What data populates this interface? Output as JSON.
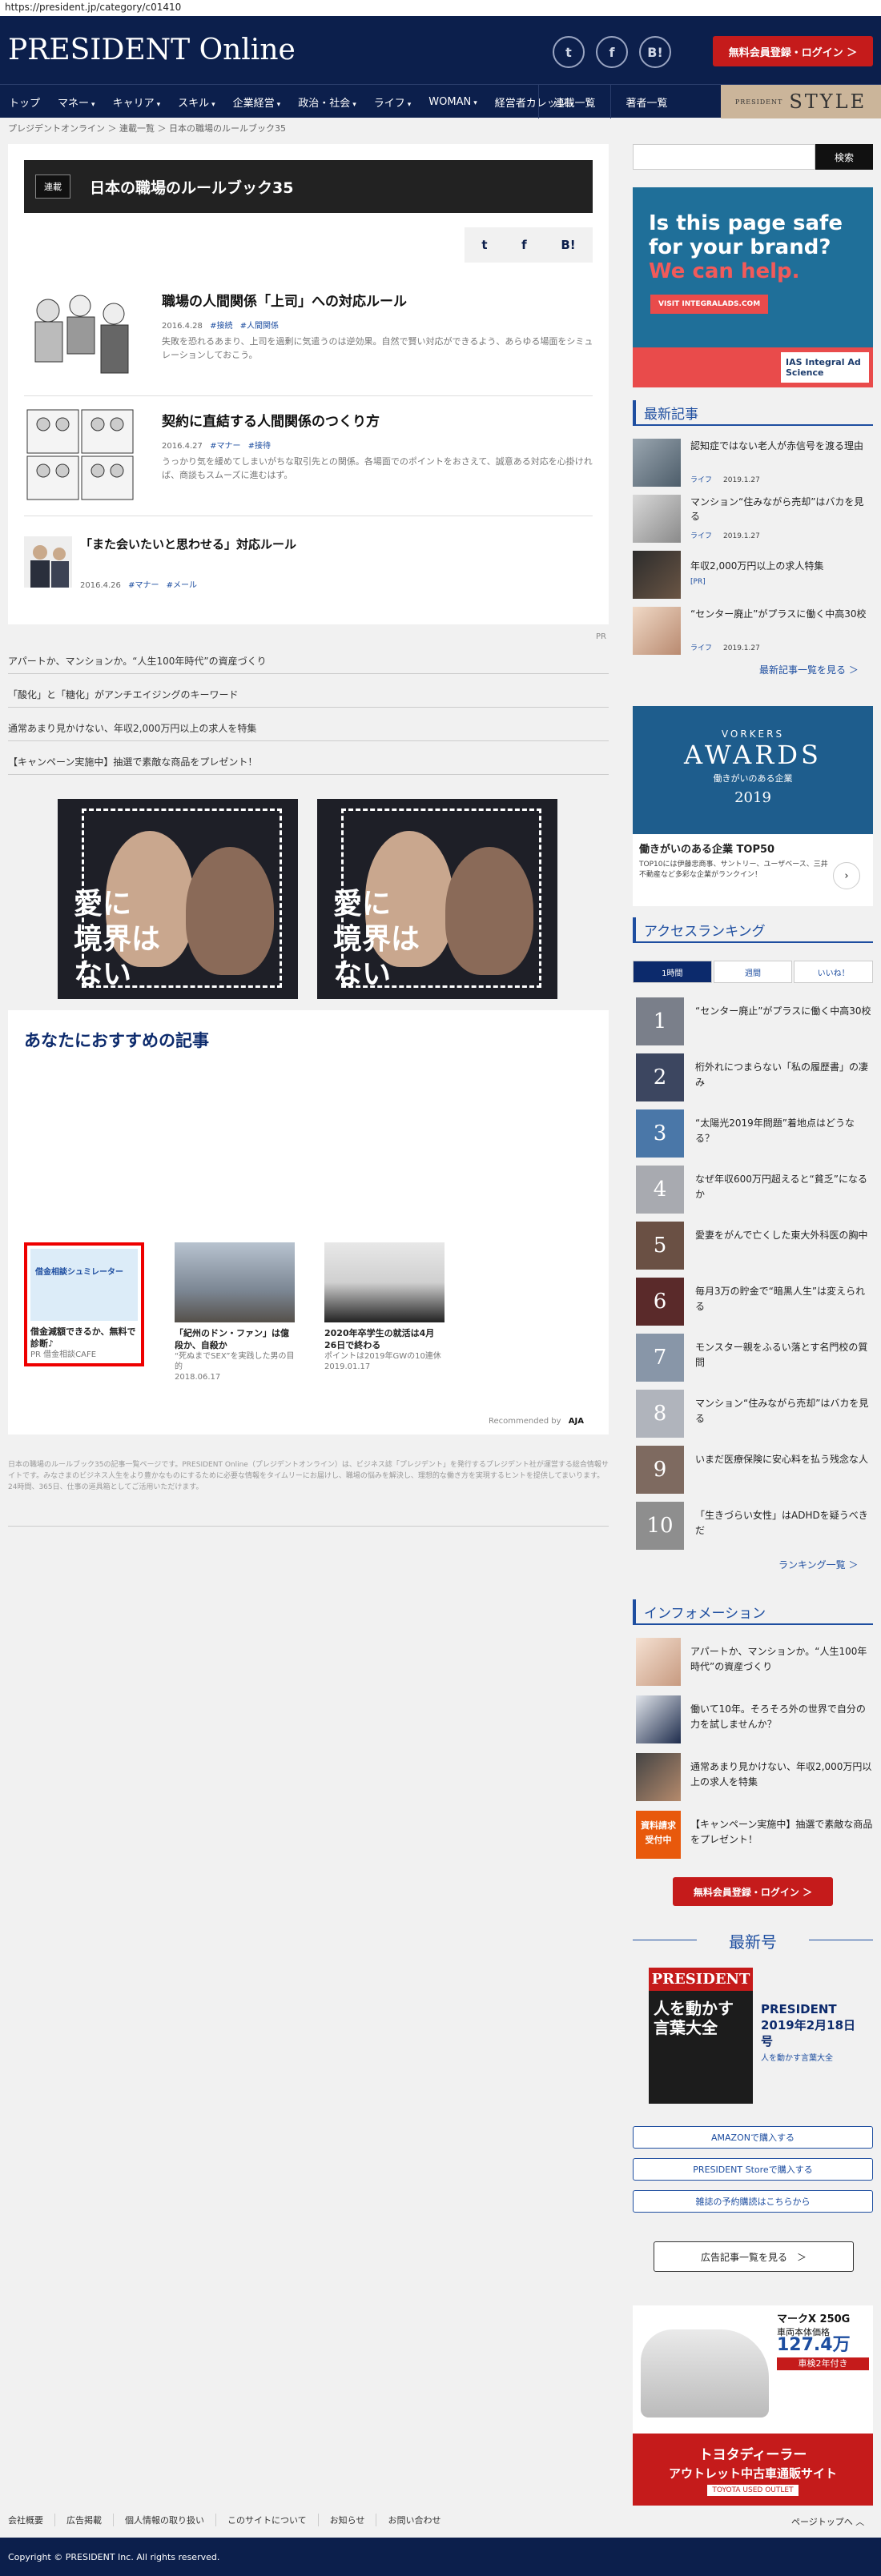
{
  "url": "https://president.jp/category/c01410",
  "header": {
    "logo": "PRESIDENT Online",
    "icon_twitter": "twitter-icon",
    "icon_facebook": "facebook-icon",
    "icon_b": "B!",
    "login": "無料会員登録・ログイン ＞"
  },
  "nav": {
    "items": [
      "トップ",
      "マネー",
      "キャリア",
      "スキル",
      "企業経営",
      "政治・社会",
      "ライフ",
      "WOMAN",
      "経営者カレッジ"
    ],
    "right": [
      "連載一覧",
      "著者一覧"
    ],
    "style_small": "PRESIDENT",
    "style_big": "STYLE"
  },
  "breadcrumb": [
    "プレジデントオンライン",
    "連載一覧",
    "日本の職場のルールブック35"
  ],
  "category": {
    "tag": "連載",
    "title": "日本の職場のルールブック35"
  },
  "share": {
    "twitter": "t",
    "facebook": "f",
    "hatena": "B!"
  },
  "articles": [
    {
      "title": "職場の人間関係「上司」への対応ルール",
      "date": "2016.4.28",
      "tags": [
        "#接続",
        "#人間関係"
      ],
      "desc": "失敗を恐れるあまり、上司を過剰に気遣うのは逆効果。自然で賢い対応ができるよう、あらゆる場面をシミュレーションしておこう。"
    },
    {
      "title": "契約に直結する人間関係のつくり方",
      "date": "2016.4.27",
      "tags": [
        "#マナー",
        "#接待"
      ],
      "desc": "うっかり気を緩めてしまいがちな取引先との関係。各場面でのポイントをおさえて、誠意ある対応を心掛ければ、商談もスムーズに進むはず。"
    },
    {
      "title": "「また会いたいと思わせる」対応ルール",
      "date": "2016.4.26",
      "tags": [
        "#マナー",
        "#メール"
      ],
      "desc": ""
    }
  ],
  "pr_label": "PR",
  "pr_links": [
    "アパートか、マンションか。“人生100年時代”の資産づくり",
    "「酸化」と「糖化」がアンチエイジングのキーワード",
    "通常あまり見かけない、年収2,000万円以上の求人を特集",
    "【キャンペーン実施中】抽選で素敵な商品をプレゼント！"
  ],
  "banner": {
    "text_line1": "愛に",
    "text_line2": "境界は",
    "text_line3": "ない"
  },
  "recommend": {
    "title": "あなたにおすすめの記事",
    "items": [
      {
        "title": "借金減額できるか、無料で診断♪",
        "sub": "PR 借金相談CAFE",
        "date": "",
        "img_text": "借金相談シュミレーター"
      },
      {
        "title": "「紀州のドン・ファン」は億段か、自殺か",
        "sub": "“死ぬまでSEX”を実践した男の目的",
        "date": "2018.06.17",
        "img_text": ""
      },
      {
        "title": "2020年卒学生の就活は4月26日で終わる",
        "sub": "ポイントは2019年GWの10連休",
        "date": "2019.01.17",
        "img_text": ""
      }
    ],
    "recommended_by": "Recommended by",
    "brand": "AJA"
  },
  "footer_desc": "日本の職場のルールブック35の記事一覧ページです。PRESIDENT Online（プレジデントオンライン）は、ビジネス誌「プレジデント」を発行するプレジデント社が運営する総合情報サイトです。みなさまのビジネス人生をより豊かなものにするために必要な情報をタイムリーにお届けし、職場の悩みを解決し、理想的な働き方を実現するヒントを提供してまいります。24時間、365日、仕事の道具箱としてご活用いただけます。",
  "search": {
    "placeholder": "",
    "button": "検索"
  },
  "ias_ad": {
    "line1": "Is this page safe",
    "line2": "for your brand?",
    "line3": "We can help.",
    "cta": "VISIT INTEGRALADS.COM",
    "brand": "IAS Integral Ad Science"
  },
  "latest_head": "最新記事",
  "latest": [
    {
      "title": "認知症ではない老人が赤信号を渡る理由",
      "cat": "ライフ",
      "date": "2019.1.27"
    },
    {
      "title": "マンション“住みながら売却”はバカを見る",
      "cat": "ライフ",
      "date": "2019.1.27"
    },
    {
      "title": "年収2,000万円以上の求人特集",
      "cat": "[PR]",
      "date": ""
    },
    {
      "title": "“センター廃止”がプラスに働く中高30校",
      "cat": "ライフ",
      "date": "2019.1.27"
    }
  ],
  "latest_more": "最新記事一覧を見る ＞",
  "vorkers": {
    "a": "VORKERS",
    "b": "AWARDS",
    "c": "働きがいのある企業",
    "d": "2019",
    "head": "働きがいのある企業 TOP50",
    "desc": "TOP10には伊藤忠商事、サントリー、ユーザベース、三井不動産など多彩な企業がランクイン！"
  },
  "ranking_head": "アクセスランキング",
  "ranking_tabs": [
    "1時間",
    "週間",
    "いいね！"
  ],
  "ranking": [
    "“センター廃止”がプラスに働く中高30校",
    "桁外れにつまらない「私の履歴書」の凄み",
    "“太陽光2019年問題”着地点はどうなる？",
    "なぜ年収600万円超えると“貧乏”になるか",
    "愛妻をがんで亡くした東大外科医の胸中",
    "毎月3万の貯金で“暗黒人生”は変えられる",
    "モンスター親をふるい落とす名門校の質問",
    "マンション“住みながら売却”はバカを見る",
    "いまだ医療保険に安心料を払う残念な人",
    "「生きづらい女性」はADHDを疑うべきだ"
  ],
  "ranking_more": "ランキング一覧 ＞",
  "info_head": "インフォメーション",
  "info": [
    "アパートか、マンションか。“人生100年時代”の資産づくり",
    "働いて10年。そろそろ外の世界で自分の力を試しませんか？",
    "通常あまり見かけない、年収2,000万円以上の求人を特集",
    "【キャンペーン実施中】抽選で素敵な商品をプレゼント！"
  ],
  "info_badge": "資料請求受付中",
  "login2": "無料会員登録・ログイン ＞",
  "issue": {
    "head": "最新号",
    "magazine": "PRESIDENT",
    "cover_text": "人を動かす言葉大全",
    "name": "PRESIDENT 2019年2月18日号",
    "sub": "人を動かす言葉大全"
  },
  "buy": [
    "AMAZONで購入する",
    "PRESIDENT Storeで購入する",
    "雑誌の予約購読はこちらから"
  ],
  "ad_list": "広告記事一覧を見る　＞",
  "toyota": {
    "mark": "マークX 250G",
    "price_label": "車両本体価格",
    "price": "127.4万",
    "badge": "車検2年付き",
    "line1": "トヨタディーラー",
    "line2": "アウトレット中古車通販サイト",
    "brand": "TOYOTA USED OUTLET"
  },
  "footer": {
    "links": [
      "会社概要",
      "広告掲載",
      "個人情報の取り扱い",
      "このサイトについて",
      "お知らせ",
      "お問い合わせ"
    ],
    "pagetop": "ページトップへ ︿",
    "copyright": "Copyright © PRESIDENT Inc. All rights reserved."
  }
}
